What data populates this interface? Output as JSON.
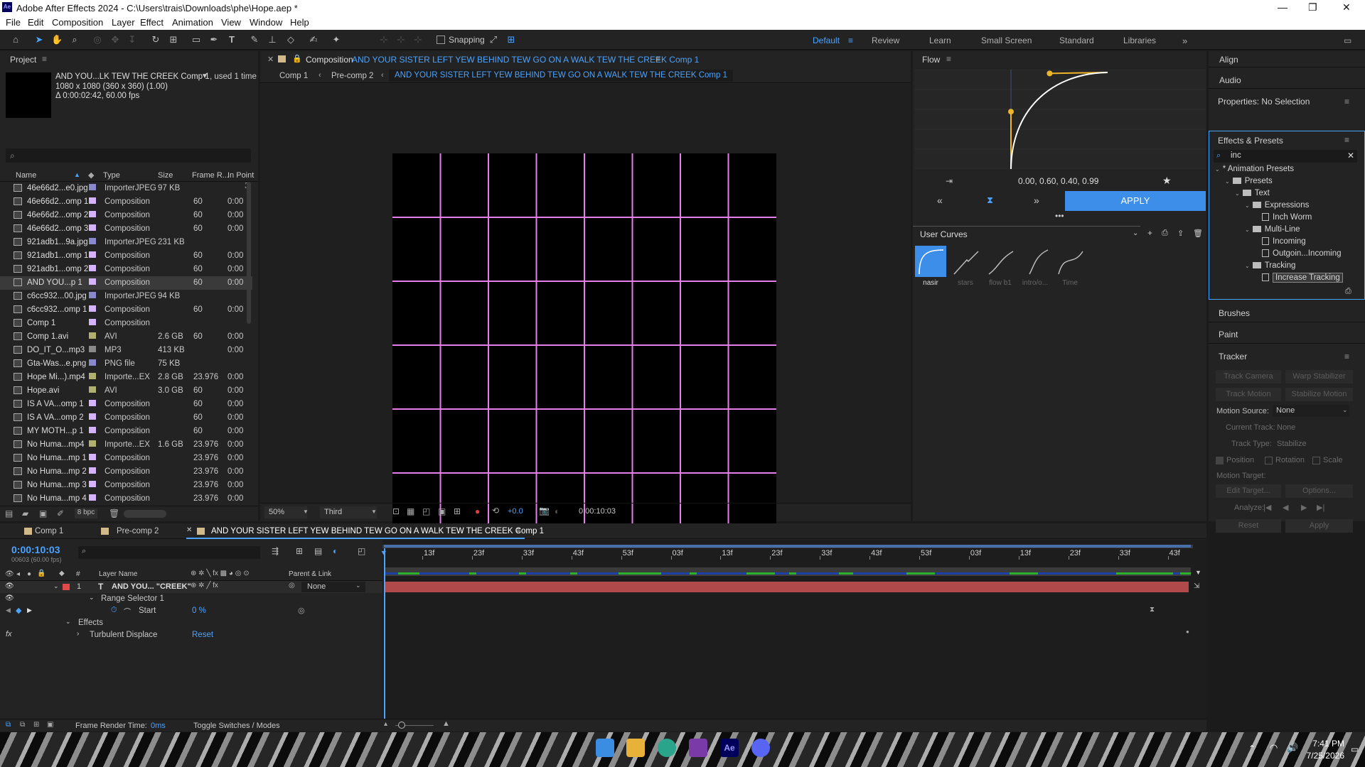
{
  "window": {
    "title": "Adobe After Effects 2024 - C:\\Users\\trais\\Downloads\\phe\\Hope.aep *",
    "app_badge": "Ae"
  },
  "menu": [
    "File",
    "Edit",
    "Composition",
    "Layer",
    "Effect",
    "Animation",
    "View",
    "Window",
    "Help"
  ],
  "toolbar": {
    "snapping": "Snapping"
  },
  "workspaces": [
    {
      "label": "Default",
      "active": true
    },
    {
      "label": "Review"
    },
    {
      "label": "Learn"
    },
    {
      "label": "Small Screen"
    },
    {
      "label": "Standard"
    },
    {
      "label": "Libraries"
    }
  ],
  "project": {
    "title": "Project",
    "selected_name": "AND YOU...LK TEW THE CREEK Comp 1",
    "used": ", used 1 time",
    "dims": "1080 x 1080  (360 x 360) (1.00)",
    "duration": "Δ 0:00:02:42, 60.00 fps",
    "search_placeholder": "",
    "columns": [
      "Name",
      "Type",
      "Size",
      "Frame R...",
      "In Point"
    ],
    "bpc": "8 bpc",
    "items": [
      {
        "name": "46e66d2...e0.jpg",
        "type": "ImporterJPEG",
        "size": "97 KB",
        "fr": "",
        "inp": "",
        "color": "#8888cc",
        "icon": "img"
      },
      {
        "name": "46e66d2...omp 1",
        "type": "Composition",
        "size": "",
        "fr": "60",
        "inp": "0:00",
        "color": "#d4b3ff",
        "icon": "comp"
      },
      {
        "name": "46e66d2...omp 2",
        "type": "Composition",
        "size": "",
        "fr": "60",
        "inp": "0:00",
        "color": "#d4b3ff",
        "icon": "comp"
      },
      {
        "name": "46e66d2...omp 3",
        "type": "Composition",
        "size": "",
        "fr": "60",
        "inp": "0:00",
        "color": "#d4b3ff",
        "icon": "comp"
      },
      {
        "name": "921adb1...9a.jpg",
        "type": "ImporterJPEG",
        "size": "231 KB",
        "fr": "",
        "inp": "",
        "color": "#8888cc",
        "icon": "img"
      },
      {
        "name": "921adb1...omp 1",
        "type": "Composition",
        "size": "",
        "fr": "60",
        "inp": "0:00",
        "color": "#d4b3ff",
        "icon": "comp"
      },
      {
        "name": "921adb1...omp 2",
        "type": "Composition",
        "size": "",
        "fr": "60",
        "inp": "0:00",
        "color": "#d4b3ff",
        "icon": "comp"
      },
      {
        "name": "AND YOU...p 1",
        "type": "Composition",
        "size": "",
        "fr": "60",
        "inp": "0:00",
        "color": "#d4b3ff",
        "icon": "comp",
        "selected": true
      },
      {
        "name": "c6cc932...00.jpg",
        "type": "ImporterJPEG",
        "size": "94 KB",
        "fr": "",
        "inp": "",
        "color": "#8888cc",
        "icon": "img"
      },
      {
        "name": "c6cc932...omp 1",
        "type": "Composition",
        "size": "",
        "fr": "60",
        "inp": "0:00",
        "color": "#d4b3ff",
        "icon": "comp"
      },
      {
        "name": "Comp 1",
        "type": "Composition",
        "size": "",
        "fr": "",
        "inp": "",
        "color": "#d4b3ff",
        "icon": "comp"
      },
      {
        "name": "Comp 1.avi",
        "type": "AVI",
        "size": "2.6 GB",
        "fr": "60",
        "inp": "0:00",
        "color": "#b0b070",
        "icon": "media"
      },
      {
        "name": "DO_IT_O...mp3",
        "type": "MP3",
        "size": "413 KB",
        "fr": "",
        "inp": "0:00",
        "color": "#8a8a8a",
        "icon": "media"
      },
      {
        "name": "Gta-Was...e.png",
        "type": "PNG file",
        "size": "75 KB",
        "fr": "",
        "inp": "",
        "color": "#8888cc",
        "icon": "img"
      },
      {
        "name": "Hope Mi...).mp4",
        "type": "Importe...EX",
        "size": "2.8 GB",
        "fr": "23.976",
        "inp": "0:00",
        "color": "#b0b070",
        "icon": "media"
      },
      {
        "name": "Hope.avi",
        "type": "AVI",
        "size": "3.0 GB",
        "fr": "60",
        "inp": "0:00",
        "color": "#b0b070",
        "icon": "media"
      },
      {
        "name": "IS A VA...omp 1",
        "type": "Composition",
        "size": "",
        "fr": "60",
        "inp": "0:00",
        "color": "#d4b3ff",
        "icon": "comp"
      },
      {
        "name": "IS A VA...omp 2",
        "type": "Composition",
        "size": "",
        "fr": "60",
        "inp": "0:00",
        "color": "#d4b3ff",
        "icon": "comp"
      },
      {
        "name": "MY MOTH...p 1",
        "type": "Composition",
        "size": "",
        "fr": "60",
        "inp": "0:00",
        "color": "#d4b3ff",
        "icon": "comp"
      },
      {
        "name": "No Huma...mp4",
        "type": "Importe...EX",
        "size": "1.6 GB",
        "fr": "23.976",
        "inp": "0:00",
        "color": "#b0b070",
        "icon": "media"
      },
      {
        "name": "No Huma...mp 1",
        "type": "Composition",
        "size": "",
        "fr": "23.976",
        "inp": "0:00",
        "color": "#d4b3ff",
        "icon": "comp"
      },
      {
        "name": "No Huma...mp 2",
        "type": "Composition",
        "size": "",
        "fr": "23.976",
        "inp": "0:00",
        "color": "#d4b3ff",
        "icon": "comp"
      },
      {
        "name": "No Huma...mp 3",
        "type": "Composition",
        "size": "",
        "fr": "23.976",
        "inp": "0:00",
        "color": "#d4b3ff",
        "icon": "comp"
      },
      {
        "name": "No Huma...mp 4",
        "type": "Composition",
        "size": "",
        "fr": "23.976",
        "inp": "0:00",
        "color": "#d4b3ff",
        "icon": "comp"
      }
    ]
  },
  "comp_viewer": {
    "panel_label": "Composition",
    "comp_name": "AND YOUR SISTER LEFT YEW BEHIND TEW GO ON A WALK TEW THE CREEK Comp 1",
    "breadcrumbs": [
      "Comp 1",
      "Pre-comp 2",
      "AND YOUR SISTER LEFT YEW BEHIND TEW GO ON A WALK TEW THE CREEK Comp 1"
    ],
    "zoom": "50%",
    "resolution": "Third",
    "exposure": "+0.0",
    "timecode": "0:00:10:03",
    "grid_color": "#e57ee8"
  },
  "flow": {
    "title": "Flow",
    "values": "0.00, 0.60, 0.40, 0.99",
    "apply": "APPLY",
    "user_curves": "User Curves",
    "curves": [
      "nasir",
      "stars",
      "flow b1",
      "intro/o...",
      "Time"
    ],
    "accent": "#3d8ee8"
  },
  "right": {
    "align": "Align",
    "audio": "Audio",
    "properties": "Properties: No Selection",
    "effects_title": "Effects & Presets",
    "search": "inc",
    "tree": [
      {
        "label": "* Animation Presets",
        "depth": 0,
        "kind": "root"
      },
      {
        "label": "Presets",
        "depth": 1,
        "kind": "folder"
      },
      {
        "label": "Text",
        "depth": 2,
        "kind": "folder"
      },
      {
        "label": "Expressions",
        "depth": 3,
        "kind": "folder"
      },
      {
        "label": "Inch Worm",
        "depth": 4,
        "kind": "preset"
      },
      {
        "label": "Multi-Line",
        "depth": 3,
        "kind": "folder"
      },
      {
        "label": "Incoming",
        "depth": 4,
        "kind": "preset"
      },
      {
        "label": "Outgoin...Incoming",
        "depth": 4,
        "kind": "preset"
      },
      {
        "label": "Tracking",
        "depth": 3,
        "kind": "folder"
      },
      {
        "label": "Increase Tracking",
        "depth": 4,
        "kind": "preset",
        "selected": true
      }
    ],
    "brushes": "Brushes",
    "paint": "Paint",
    "tracker": {
      "title": "Tracker",
      "track_camera": "Track Camera",
      "warp_stabilizer": "Warp Stabilizer",
      "track_motion": "Track Motion",
      "stabilize_motion": "Stabilize Motion",
      "motion_source_label": "Motion Source:",
      "motion_source": "None",
      "current_track_label": "Current Track:",
      "current_track": "None",
      "track_type_label": "Track Type:",
      "track_type": "Stabilize",
      "position": "Position",
      "rotation": "Rotation",
      "scale": "Scale",
      "motion_target": "Motion Target:",
      "edit_target": "Edit Target...",
      "options": "Options...",
      "analyze": "Analyze:",
      "reset": "Reset",
      "apply": "Apply"
    }
  },
  "timeline": {
    "tabs": [
      "Comp 1",
      "Pre-comp 2",
      "AND YOUR SISTER LEFT YEW BEHIND TEW GO ON A WALK TEW THE CREEK Comp 1"
    ],
    "timecode": "0:00:10:03",
    "frames": "00603 (60.00 fps)",
    "cols": {
      "num": "#",
      "name": "Layer Name",
      "parent": "Parent & Link"
    },
    "layer": {
      "num": "1",
      "type": "T",
      "name": "AND YOU... \"CREEK\"",
      "parent": "None"
    },
    "range_selector": "Range Selector 1",
    "start_label": "Start",
    "start_value": "0 %",
    "effects": "Effects",
    "turbulent": "Turbulent Displace",
    "reset": "Reset",
    "ruler": [
      "13f",
      "23f",
      "33f",
      "43f",
      "53f",
      "03f",
      "13f",
      "23f",
      "33f",
      "43f",
      "53f",
      "03f",
      "13f",
      "23f",
      "33f",
      "43f"
    ],
    "render_time_label": "Frame Render Time:",
    "render_time": "0ms",
    "toggle": "Toggle Switches / Modes",
    "layer_color": "#b04a4a"
  },
  "taskbar": {
    "time": "7:41 PM",
    "date": "7/25/2026"
  }
}
